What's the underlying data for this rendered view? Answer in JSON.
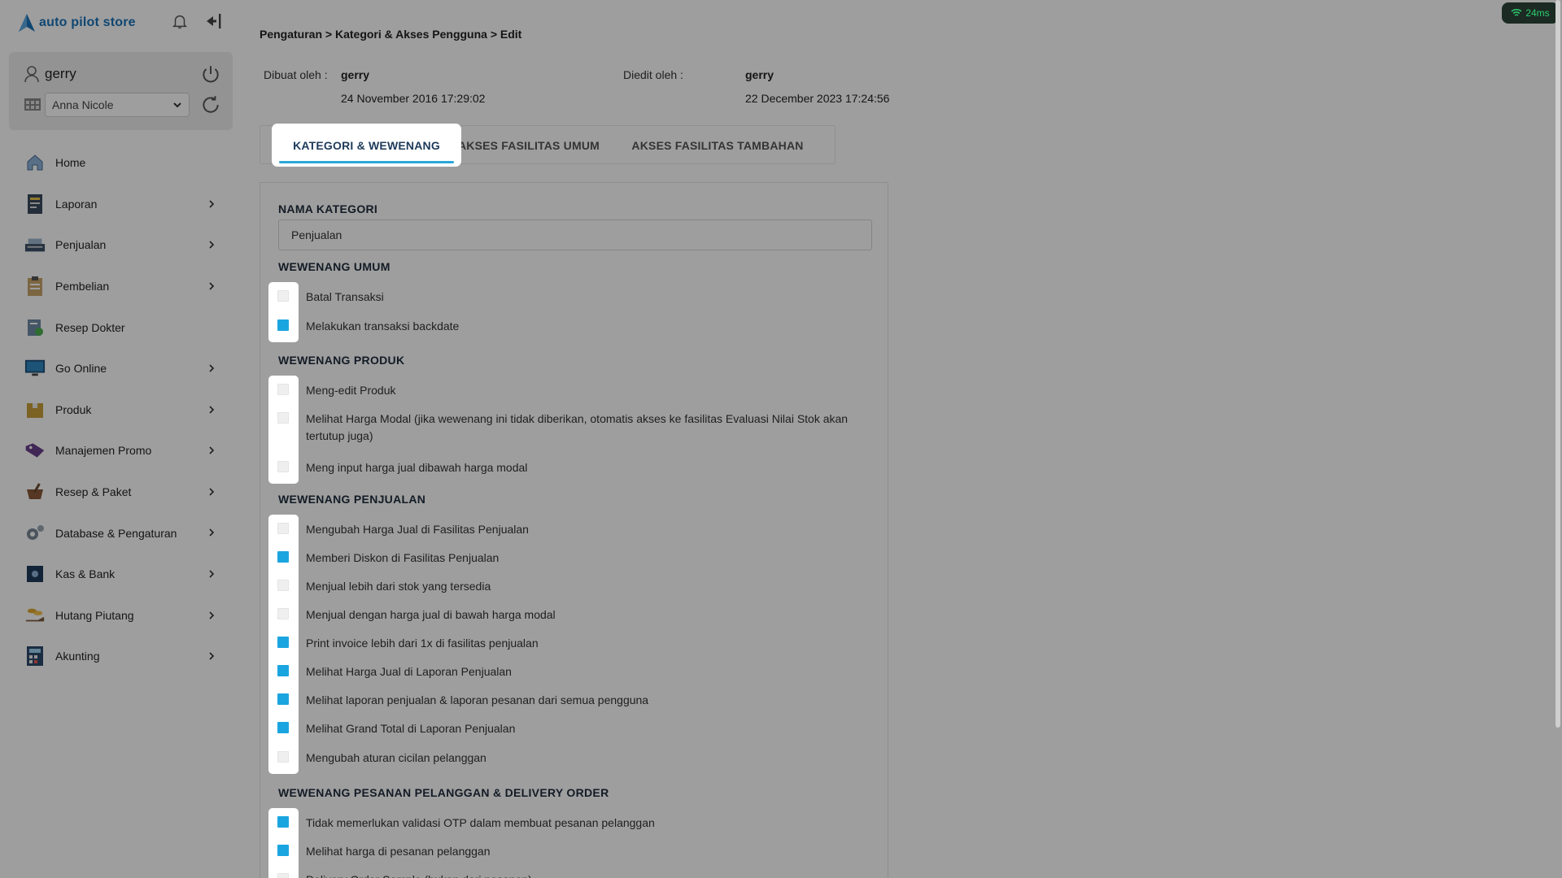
{
  "brand": {
    "name": "auto pilot store"
  },
  "user": {
    "name": "gerry",
    "branch": "Anna Nicole"
  },
  "nav": [
    {
      "label": "Home",
      "icon": "home-icon",
      "has_children": false
    },
    {
      "label": "Laporan",
      "icon": "report-icon",
      "has_children": true
    },
    {
      "label": "Penjualan",
      "icon": "cashier-icon",
      "has_children": true
    },
    {
      "label": "Pembelian",
      "icon": "clipboard-icon",
      "has_children": true
    },
    {
      "label": "Resep Dokter",
      "icon": "prescription-icon",
      "has_children": false
    },
    {
      "label": "Go Online",
      "icon": "monitor-icon",
      "has_children": true
    },
    {
      "label": "Produk",
      "icon": "box-icon",
      "has_children": true
    },
    {
      "label": "Manajemen Promo",
      "icon": "tag-icon",
      "has_children": true
    },
    {
      "label": "Resep & Paket",
      "icon": "mortar-icon",
      "has_children": true
    },
    {
      "label": "Database & Pengaturan",
      "icon": "gears-icon",
      "has_children": true
    },
    {
      "label": "Kas & Bank",
      "icon": "safe-icon",
      "has_children": true
    },
    {
      "label": "Hutang Piutang",
      "icon": "coins-hand-icon",
      "has_children": true
    },
    {
      "label": "Akunting",
      "icon": "calculator-icon",
      "has_children": true
    }
  ],
  "breadcrumb": "Pengaturan > Kategori & Akses Pengguna > Edit",
  "meta": {
    "created_label": "Dibuat oleh :",
    "created_by": "gerry",
    "created_at": "24 November 2016 17:29:02",
    "edited_label": "Diedit oleh :",
    "edited_by": "gerry",
    "edited_at": "22 December 2023 17:24:56"
  },
  "tabs": [
    {
      "label": "KATEGORI & WEWENANG",
      "active": true
    },
    {
      "label": "AKSES FASILITAS UMUM",
      "active": false
    },
    {
      "label": "AKSES FASILITAS TAMBAHAN",
      "active": false
    }
  ],
  "form": {
    "name_label": "NAMA KATEGORI",
    "name_value": "Penjualan",
    "sections": [
      {
        "title": "WEWENANG UMUM",
        "items": [
          {
            "label": "Batal Transaksi",
            "checked": false
          },
          {
            "label": "Melakukan transaksi backdate",
            "checked": true
          }
        ]
      },
      {
        "title": "WEWENANG PRODUK",
        "items": [
          {
            "label": "Meng-edit Produk",
            "checked": false
          },
          {
            "label": "Melihat Harga Modal (jika wewenang ini tidak diberikan, otomatis akses ke fasilitas Evaluasi Nilai Stok akan tertutup juga)",
            "checked": false
          },
          {
            "label": "Meng input harga jual dibawah harga modal",
            "checked": false
          }
        ]
      },
      {
        "title": "WEWENANG PENJUALAN",
        "items": [
          {
            "label": "Mengubah Harga Jual di Fasilitas Penjualan",
            "checked": false
          },
          {
            "label": "Memberi Diskon di Fasilitas Penjualan",
            "checked": true
          },
          {
            "label": "Menjual lebih dari stok yang tersedia",
            "checked": false
          },
          {
            "label": "Menjual dengan harga jual di bawah harga modal",
            "checked": false
          },
          {
            "label": "Print invoice lebih dari 1x di fasilitas penjualan",
            "checked": true
          },
          {
            "label": "Melihat Harga Jual di Laporan Penjualan",
            "checked": true
          },
          {
            "label": "Melihat laporan penjualan & laporan pesanan dari semua pengguna",
            "checked": true
          },
          {
            "label": "Melihat Grand Total di Laporan Penjualan",
            "checked": true
          },
          {
            "label": "Mengubah aturan cicilan pelanggan",
            "checked": false
          }
        ]
      },
      {
        "title": "WEWENANG PESANAN PELANGGAN & DELIVERY ORDER",
        "items": [
          {
            "label": "Tidak memerlukan validasi OTP dalam membuat pesanan pelanggan",
            "checked": true
          },
          {
            "label": "Melihat harga di pesanan pelanggan",
            "checked": true
          },
          {
            "label": "Delivery Order Sample (bukan dari pesanan)",
            "checked": false
          }
        ]
      }
    ]
  },
  "status": {
    "ping": "24ms"
  },
  "colors": {
    "accent": "#1ba5e0",
    "brand": "#1a73b8",
    "ping": "#2ecc71"
  }
}
